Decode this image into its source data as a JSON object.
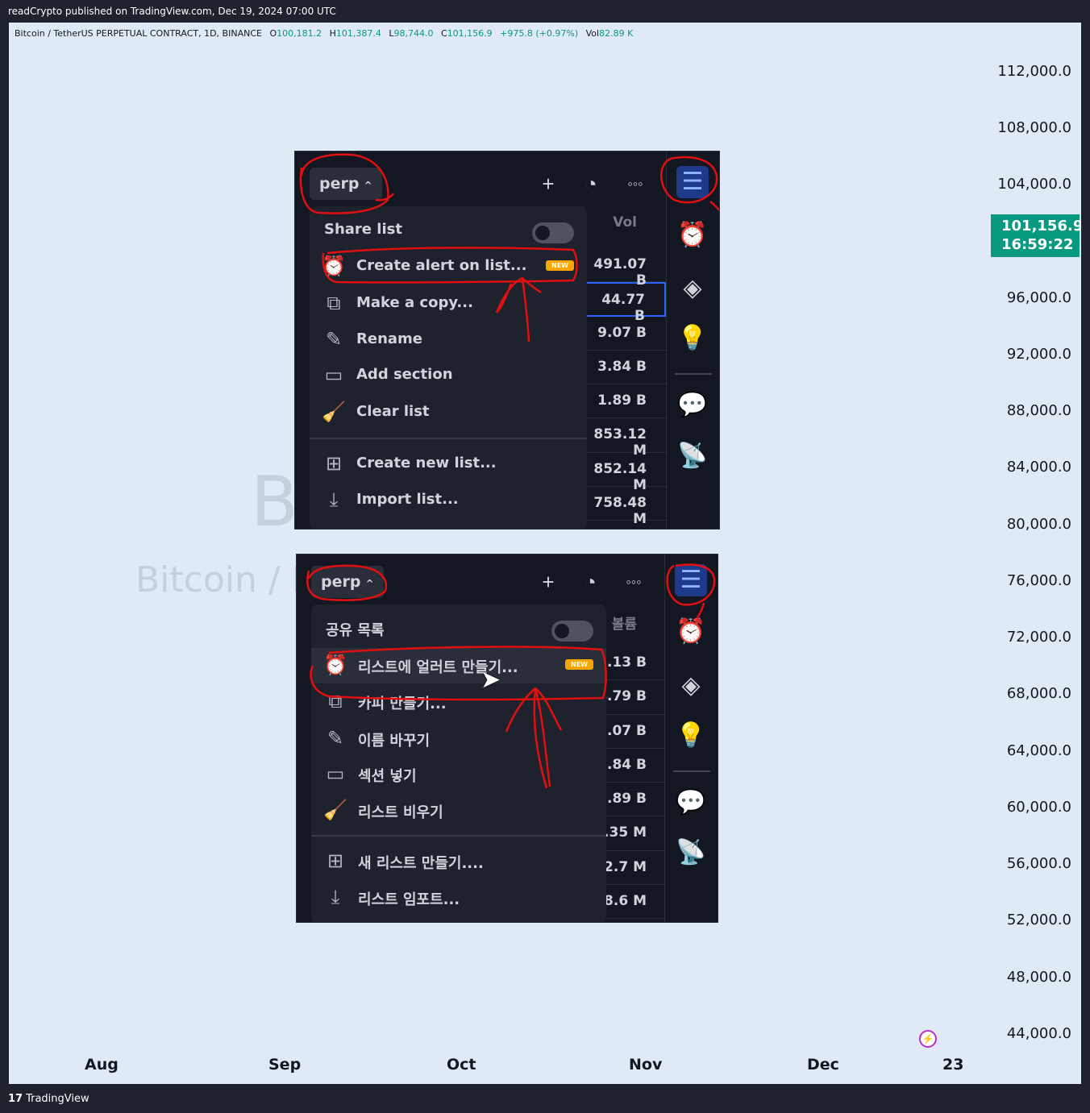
{
  "header": {
    "published": "readCrypto published on TradingView.com, Dec 19, 2024 07:00 UTC"
  },
  "legend": {
    "symbol": "Bitcoin / TetherUS PERPETUAL CONTRACT, 1D, BINANCE",
    "o_label": "O",
    "o_value": "100,181.2",
    "h_label": "H",
    "h_value": "101,387.4",
    "l_label": "L",
    "l_value": "98,744.0",
    "c_label": "C",
    "c_value": "101,156.9",
    "change": "+975.8 (+0.97%)",
    "vol_label": "Vol",
    "vol_value": "82.89 K"
  },
  "watermark": {
    "big": "B                    D",
    "small": "Bitcoin /                                    NTRACT"
  },
  "price_axis": {
    "ticks": [
      "112,000.0",
      "108,000.0",
      "104,000.0",
      "96,000.0",
      "92,000.0",
      "88,000.0",
      "84,000.0",
      "80,000.0",
      "76,000.0",
      "72,000.0",
      "68,000.0",
      "64,000.0",
      "60,000.0",
      "56,000.0",
      "52,000.0",
      "48,000.0",
      "44,000.0"
    ],
    "current_price": "101,156.9",
    "countdown": "16:59:22"
  },
  "time_axis": {
    "ticks": [
      "Aug",
      "Sep",
      "Oct",
      "Nov",
      "Dec",
      "23"
    ]
  },
  "footer": {
    "logo_mark": "17",
    "brand": "TradingView"
  },
  "shot_en": {
    "list_name": "perp",
    "vol_header": "Vol",
    "vol_values": [
      "491.07 B",
      "44.77 B",
      "9.07 B",
      "3.84 B",
      "1.89 B",
      "853.12 M",
      "852.14 M",
      "758.48 M"
    ],
    "menu": {
      "share": "Share list",
      "create_alert": "Create alert on list...",
      "badge": "NEW",
      "copy": "Make a copy...",
      "rename": "Rename",
      "add_section": "Add section",
      "clear": "Clear list",
      "create_new": "Create new list...",
      "import": "Import list..."
    }
  },
  "shot_ko": {
    "list_name": "perp",
    "vol_header": "볼륨",
    "vol_values": [
      "1.13 B",
      "4.79 B",
      "9.07 B",
      "3.84 B",
      "1.89 B",
      ".35 M",
      "52.7 M",
      "58.6 M"
    ],
    "menu": {
      "share": "공유 목록",
      "create_alert": "리스트에 얼러트 만들기...",
      "badge": "NEW",
      "copy": "카피 만들기...",
      "rename": "이름 바꾸기",
      "add_section": "섹션 넣기",
      "clear": "리스트 비우기",
      "create_new": "새 리스트 만들기....",
      "import": "리스트 임포트..."
    }
  },
  "colors": {
    "up": "#089981",
    "chart_bg": "#dfeaf6",
    "panel_bg": "#131722",
    "menu_bg": "#1e222d",
    "annotation": "#e01010",
    "badge": "#f7a600"
  }
}
